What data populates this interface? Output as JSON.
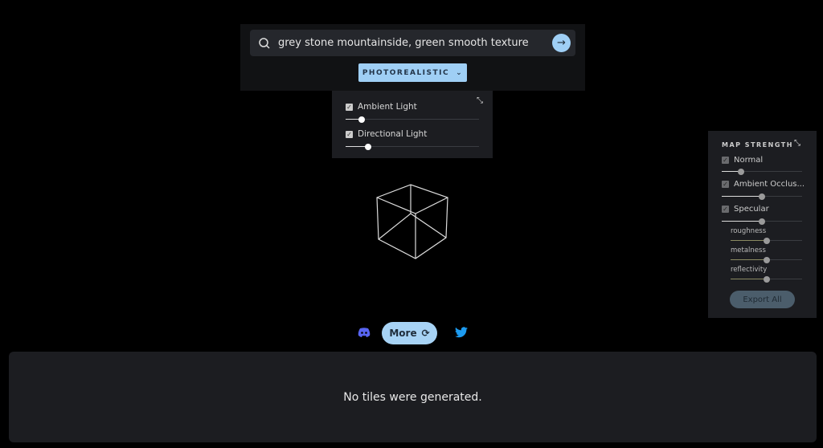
{
  "search": {
    "value": "grey stone mountainside, green smooth texture",
    "icon": "search-icon",
    "submit_icon": "arrow-right-icon"
  },
  "style_dropdown": {
    "selected": "PHOTOREALISTIC"
  },
  "lighting": {
    "items": [
      {
        "label": "Ambient Light",
        "checked": true,
        "value_percent": 12
      },
      {
        "label": "Directional Light",
        "checked": true,
        "value_percent": 17
      }
    ]
  },
  "map_strength": {
    "title": "MAP STRENGTH",
    "items": [
      {
        "label": "Normal",
        "checked": true,
        "value_percent": 24
      },
      {
        "label": "Ambient Occlus...",
        "checked": true,
        "value_percent": 50
      },
      {
        "label": "Specular",
        "checked": true,
        "value_percent": 50
      }
    ],
    "sub_items": [
      {
        "label": "roughness",
        "value_percent": 50
      },
      {
        "label": "metalness",
        "value_percent": 50
      },
      {
        "label": "reflectivity",
        "value_percent": 50
      }
    ],
    "export_label": "Export All"
  },
  "actions": {
    "more_label": "More"
  },
  "tiles": {
    "empty_message": "No tiles were generated."
  },
  "colors": {
    "accent": "#9fcff5",
    "discord": "#5865f2",
    "twitter": "#1d9bf0"
  }
}
